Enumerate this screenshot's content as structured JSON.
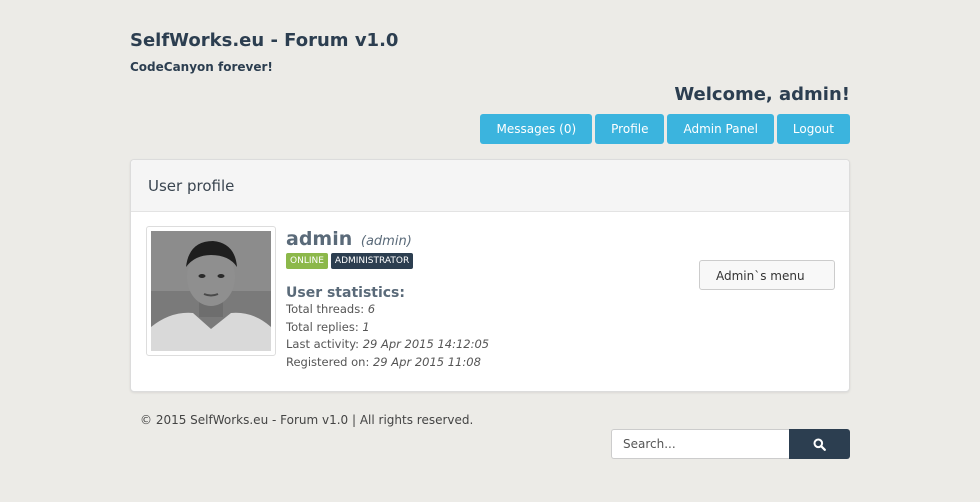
{
  "site": {
    "title": "SelfWorks.eu - Forum v1.0",
    "tagline": "CodeCanyon forever!"
  },
  "header": {
    "welcome": "Welcome, admin!",
    "nav": [
      {
        "label": "Messages (0)"
      },
      {
        "label": "Profile"
      },
      {
        "label": "Admin Panel"
      },
      {
        "label": "Logout"
      }
    ]
  },
  "profile": {
    "heading": "User profile",
    "username": "admin",
    "role": "(admin)",
    "badges": [
      "ONLINE",
      "ADMINISTRATOR"
    ],
    "stats_title": "User statistics:",
    "stats": [
      {
        "label": "Total threads:",
        "value": "6"
      },
      {
        "label": "Total replies:",
        "value": "1"
      },
      {
        "label": "Last activity:",
        "value": "29 Apr 2015 14:12:05"
      },
      {
        "label": "Registered on:",
        "value": "29 Apr 2015 11:08"
      }
    ],
    "admin_menu_label": "Admin`s menu"
  },
  "footer": {
    "copyright": "© 2015 SelfWorks.eu - Forum v1.0 | All rights reserved."
  },
  "search": {
    "placeholder": "Search...",
    "button_icon": "search-icon"
  },
  "colors": {
    "background": "#ecebe7",
    "accent": "#3bb4de",
    "dark": "#2c3e50",
    "online": "#8cb84a"
  }
}
